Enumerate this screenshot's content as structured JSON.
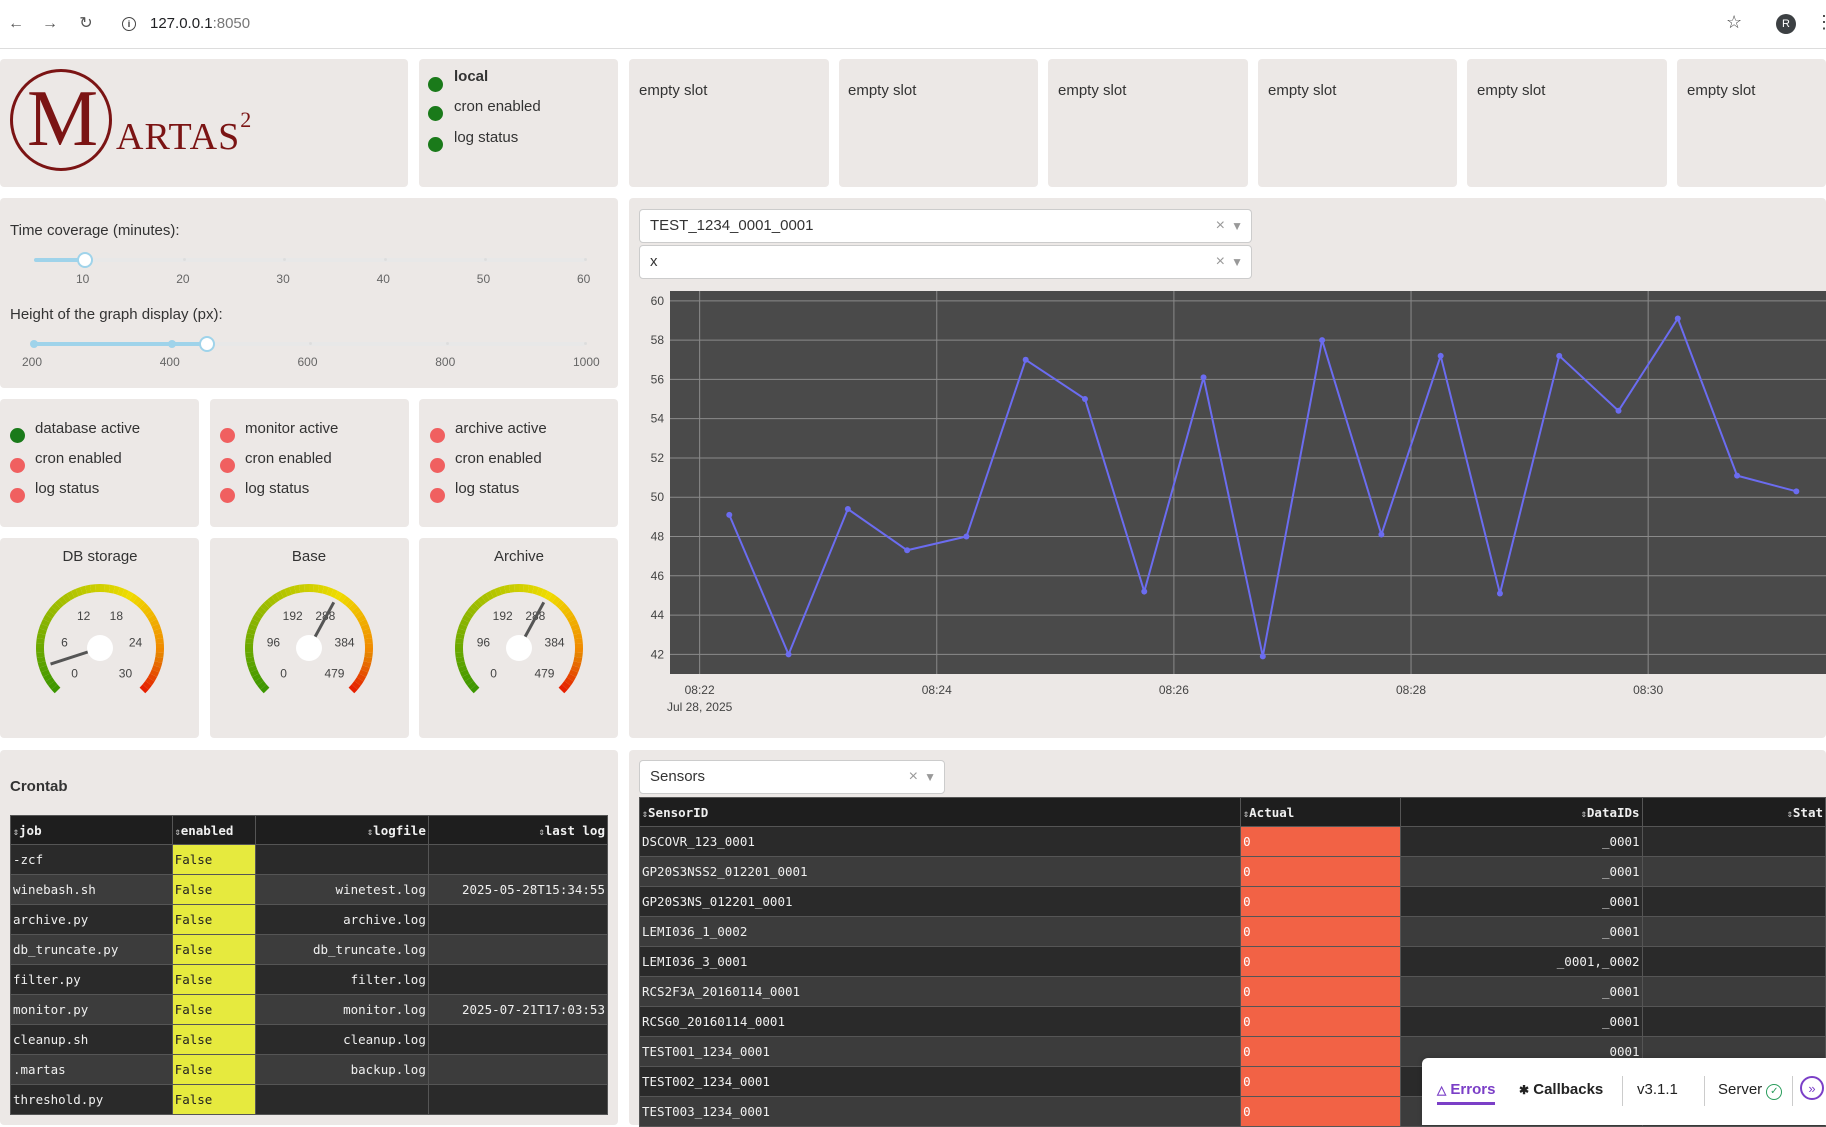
{
  "browser": {
    "url_host": "127.0.0.1",
    "url_port": ":8050",
    "profile_initial": "R"
  },
  "logo": {
    "letter": "M",
    "text": "ARTAS",
    "sup": "2"
  },
  "local_status": {
    "title": "local",
    "items": [
      {
        "label": "cron enabled",
        "color": "#1a7a1a"
      },
      {
        "label": "log status",
        "color": "#1a7a1a"
      }
    ]
  },
  "slots": [
    "empty slot",
    "empty slot",
    "empty slot",
    "empty slot",
    "empty slot",
    "empty slot"
  ],
  "controls": {
    "time_label": "Time coverage (minutes):",
    "time_ticks": [
      "10",
      "20",
      "30",
      "40",
      "50",
      "60"
    ],
    "time_value": 10,
    "height_label": "Height of the graph display (px):",
    "height_ticks": [
      "200",
      "400",
      "600",
      "800",
      "1000"
    ],
    "height_range": [
      200,
      400
    ],
    "height_extra_handle": 450
  },
  "status_boxes": [
    {
      "items": [
        {
          "label": "database active",
          "state": "green"
        },
        {
          "label": "cron enabled",
          "state": "red"
        },
        {
          "label": "log status",
          "state": "red"
        }
      ]
    },
    {
      "items": [
        {
          "label": "monitor active",
          "state": "red"
        },
        {
          "label": "cron enabled",
          "state": "red"
        },
        {
          "label": "log status",
          "state": "red"
        }
      ]
    },
    {
      "items": [
        {
          "label": "archive active",
          "state": "red"
        },
        {
          "label": "cron enabled",
          "state": "red"
        },
        {
          "label": "log status",
          "state": "red"
        }
      ]
    }
  ],
  "gauges": [
    {
      "title": "DB storage",
      "labels": [
        "0",
        "6",
        "12",
        "18",
        "24",
        "30"
      ],
      "max": 30,
      "value": 3
    },
    {
      "title": "Base",
      "labels": [
        "0",
        "96",
        "192",
        "288",
        "384",
        "479"
      ],
      "max": 479,
      "value": 290
    },
    {
      "title": "Archive",
      "labels": [
        "0",
        "96",
        "192",
        "288",
        "384",
        "479"
      ],
      "max": 479,
      "value": 290
    }
  ],
  "graph": {
    "sensor_select": "TEST_1234_0001_0001",
    "key_select": "x",
    "chart_data": {
      "type": "line",
      "x": [
        "08:22:15",
        "08:22:45",
        "08:23:15",
        "08:23:45",
        "08:24:15",
        "08:24:45",
        "08:25:15",
        "08:25:45",
        "08:26:15",
        "08:26:45",
        "08:27:15",
        "08:27:45",
        "08:28:15",
        "08:28:45",
        "08:29:15",
        "08:29:45",
        "08:30:15",
        "08:30:45",
        "08:31:15"
      ],
      "y": [
        49.1,
        42.0,
        49.4,
        47.3,
        48.0,
        57.0,
        55.0,
        45.2,
        56.1,
        41.9,
        58.0,
        48.1,
        57.2,
        45.1,
        57.2,
        54.4,
        59.1,
        51.1,
        50.3
      ],
      "xlabel": "",
      "ylabel": "",
      "x_ticks": [
        "08:22",
        "08:24",
        "08:26",
        "08:28",
        "08:30"
      ],
      "x_date_label": "Jul 28, 2025",
      "y_ticks": [
        "42",
        "44",
        "46",
        "48",
        "50",
        "52",
        "54",
        "56",
        "58",
        "60"
      ],
      "ylim": [
        41,
        60.5
      ],
      "xlim": [
        "08:21:45",
        "08:31:30"
      ],
      "grid": true,
      "line_color": "#6b6cf0",
      "bg_color": "#4a4a4a"
    }
  },
  "crontab": {
    "title": "Crontab",
    "columns": [
      "job",
      "enabled",
      "logfile",
      "last log"
    ],
    "rows": [
      [
        "-zcf",
        "False",
        "",
        ""
      ],
      [
        "winebash.sh",
        "False",
        "winetest.log",
        "2025-05-28T15:34:55"
      ],
      [
        "archive.py",
        "False",
        "archive.log",
        ""
      ],
      [
        "db_truncate.py",
        "False",
        "db_truncate.log",
        ""
      ],
      [
        "filter.py",
        "False",
        "filter.log",
        ""
      ],
      [
        "monitor.py",
        "False",
        "monitor.log",
        "2025-07-21T17:03:53"
      ],
      [
        "cleanup.sh",
        "False",
        "cleanup.log",
        ""
      ],
      [
        ".martas",
        "False",
        "backup.log",
        ""
      ],
      [
        "threshold.py",
        "False",
        "",
        ""
      ]
    ]
  },
  "sensors": {
    "select": "Sensors",
    "columns": [
      "SensorID",
      "Actual",
      "DataIDs",
      "Stat"
    ],
    "rows": [
      [
        "DSCOVR_123_0001",
        "0",
        "_0001"
      ],
      [
        "GP20S3NSS2_012201_0001",
        "0",
        "_0001"
      ],
      [
        "GP20S3NS_012201_0001",
        "0",
        "_0001"
      ],
      [
        "LEMI036_1_0002",
        "0",
        "_0001"
      ],
      [
        "LEMI036_3_0001",
        "0",
        "_0001,_0002"
      ],
      [
        "RCS2F3A_20160114_0001",
        "0",
        "_0001"
      ],
      [
        "RCSG0_20160114_0001",
        "0",
        "_0001"
      ],
      [
        "TEST001_1234_0001",
        "0",
        "_0001"
      ],
      [
        "TEST002_1234_0001",
        "0",
        ""
      ],
      [
        "TEST003_1234_0001",
        "0",
        ""
      ]
    ]
  },
  "devtools": {
    "errors": "Errors",
    "callbacks": "Callbacks",
    "version": "v3.1.1",
    "server": "Server"
  }
}
